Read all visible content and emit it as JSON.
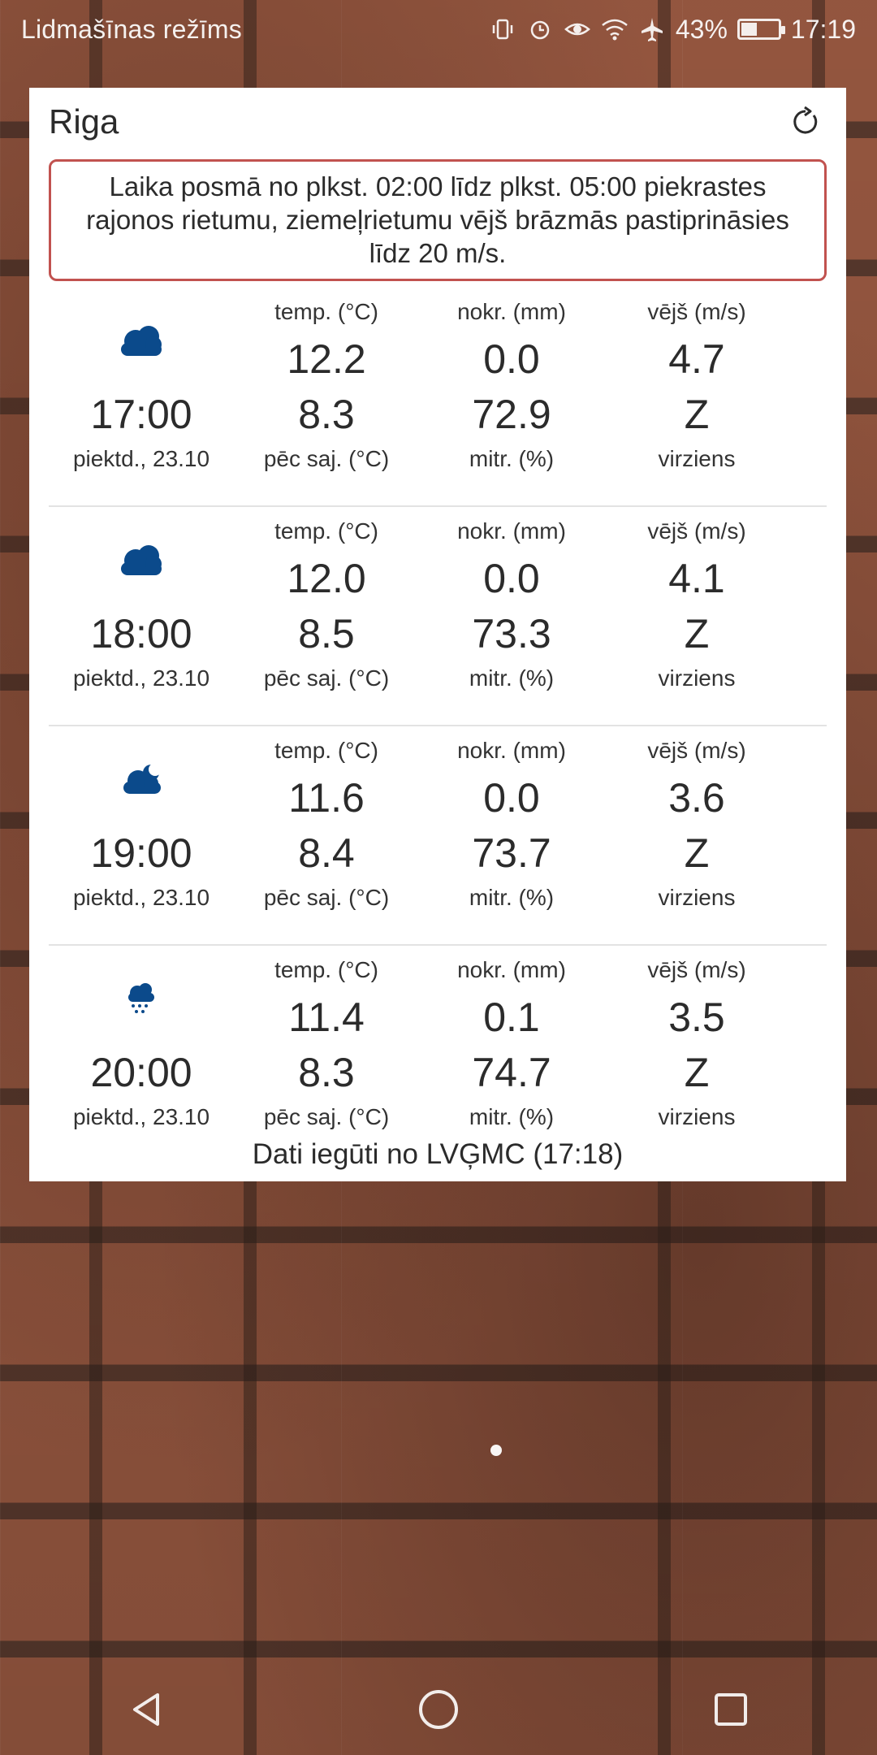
{
  "status_bar": {
    "left_text": "Lidmašīnas režīms",
    "battery_text": "43%",
    "battery_level": 0.43,
    "time": "17:19",
    "icons": [
      "vibrate-icon",
      "alarm-icon",
      "eye-comfort-icon",
      "wifi-icon",
      "airplane-icon",
      "battery-icon"
    ]
  },
  "widget": {
    "city": "Riga",
    "alert": "Laika posmā no plkst. 02:00 līdz plkst. 05:00 piekrastes rajonos rietumu, ziemeļrietumu vējš brāzmās pastiprināsies līdz 20 m/s.",
    "footer": "Dati iegūti no LVĢMC (17:18)",
    "rows": [
      {
        "icon": "cloudy-icon",
        "time": "17:00",
        "date": "piektd., 23.10",
        "temp_label": "temp. (°C)",
        "temp": "12.2",
        "feels": "8.3",
        "feels_label": "pēc saj. (°C)",
        "precip_label": "nokr. (mm)",
        "precip": "0.0",
        "humidity": "72.9",
        "humidity_label": "mitr. (%)",
        "wind_label": "vējš (m/s)",
        "wind": "4.7",
        "direction": "Z",
        "direction_label": "virziens"
      },
      {
        "icon": "cloudy-icon",
        "time": "18:00",
        "date": "piektd., 23.10",
        "temp_label": "temp. (°C)",
        "temp": "12.0",
        "feels": "8.5",
        "feels_label": "pēc saj. (°C)",
        "precip_label": "nokr. (mm)",
        "precip": "0.0",
        "humidity": "73.3",
        "humidity_label": "mitr. (%)",
        "wind_label": "vējš (m/s)",
        "wind": "4.1",
        "direction": "Z",
        "direction_label": "virziens"
      },
      {
        "icon": "cloudy-night-icon",
        "time": "19:00",
        "date": "piektd., 23.10",
        "temp_label": "temp. (°C)",
        "temp": "11.6",
        "feels": "8.4",
        "feels_label": "pēc saj. (°C)",
        "precip_label": "nokr. (mm)",
        "precip": "0.0",
        "humidity": "73.7",
        "humidity_label": "mitr. (%)",
        "wind_label": "vējš (m/s)",
        "wind": "3.6",
        "direction": "Z",
        "direction_label": "virziens"
      },
      {
        "icon": "rain-icon",
        "time": "20:00",
        "date": "piektd., 23.10",
        "temp_label": "temp. (°C)",
        "temp": "11.4",
        "feels": "8.3",
        "feels_label": "pēc saj. (°C)",
        "precip_label": "nokr. (mm)",
        "precip": "0.1",
        "humidity": "74.7",
        "humidity_label": "mitr. (%)",
        "wind_label": "vējš (m/s)",
        "wind": "3.5",
        "direction": "Z",
        "direction_label": "virziens"
      }
    ]
  },
  "nav_bar": {
    "buttons": [
      "back-icon",
      "home-icon",
      "recents-icon"
    ]
  },
  "colors": {
    "alert_border": "#c1524f",
    "weather_icon": "#0b4a8b",
    "widget_bg": "#ffffff"
  }
}
